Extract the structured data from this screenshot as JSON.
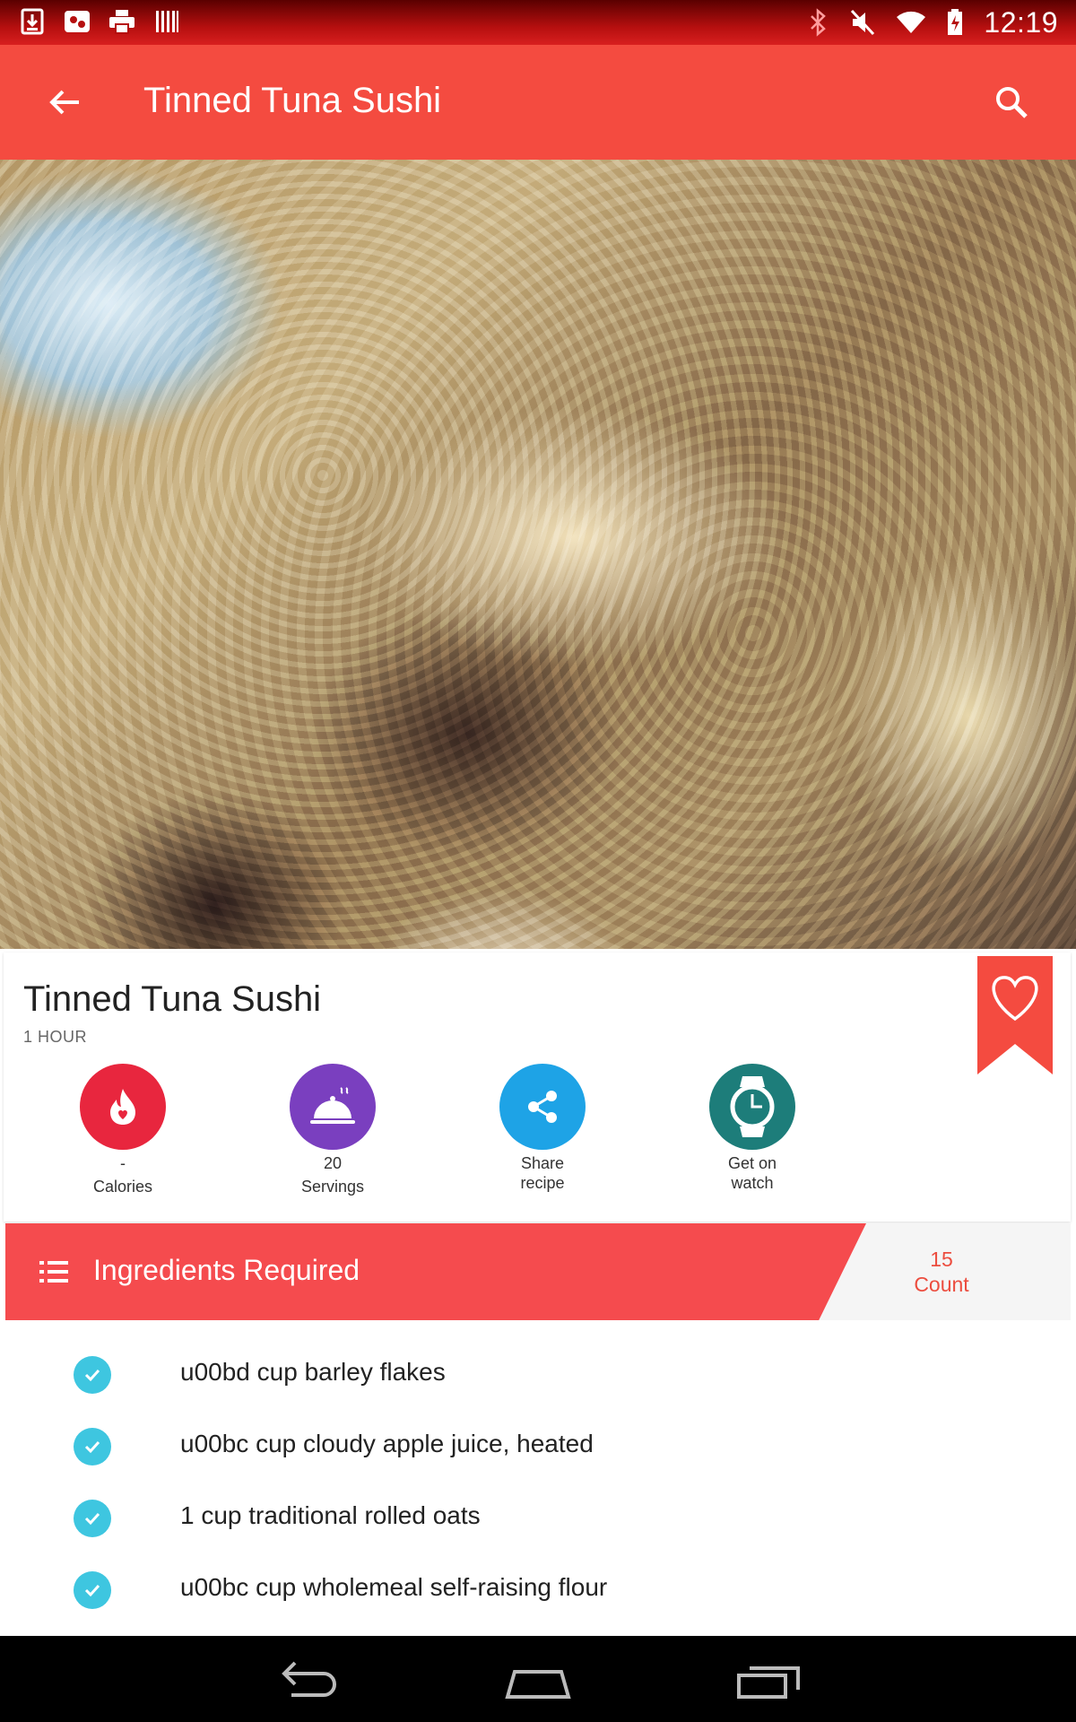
{
  "status_bar": {
    "time": "12:19",
    "left_icons": [
      "download-icon",
      "media-icon",
      "print-icon",
      "barcode-icon"
    ],
    "right_icons": [
      "bluetooth-icon",
      "muted-icon",
      "wifi-icon",
      "battery-icon"
    ]
  },
  "app_bar": {
    "title": "Tinned Tuna Sushi",
    "back_icon": "arrow-back-icon",
    "search_icon": "search-icon",
    "color": "#f44b40"
  },
  "recipe": {
    "title": "Tinned Tuna Sushi",
    "duration": "1 HOUR",
    "favorite_icon": "heart-icon",
    "actions": [
      {
        "value": "-",
        "label": "Calories",
        "icon": "flame-icon",
        "color": "#e8263e"
      },
      {
        "value": "20",
        "label": "Servings",
        "icon": "cloche-icon",
        "color": "#7a3fbf"
      },
      {
        "value": "Share",
        "label": "recipe",
        "icon": "share-icon",
        "color": "#1ea3e6"
      },
      {
        "value": "Get on",
        "label": "watch",
        "icon": "watch-icon",
        "color": "#1d7d7a"
      }
    ]
  },
  "ingredients": {
    "header": "Ingredients Required",
    "count": "15",
    "count_label": "Count",
    "items": [
      "u00bd cup barley flakes",
      "u00bc cup cloudy apple juice, heated",
      "1 cup traditional rolled oats",
      "u00bc cup wholemeal self-raising flour"
    ]
  },
  "nav_bar": {
    "buttons": [
      "back-nav-icon",
      "home-nav-icon",
      "recents-nav-icon"
    ]
  }
}
